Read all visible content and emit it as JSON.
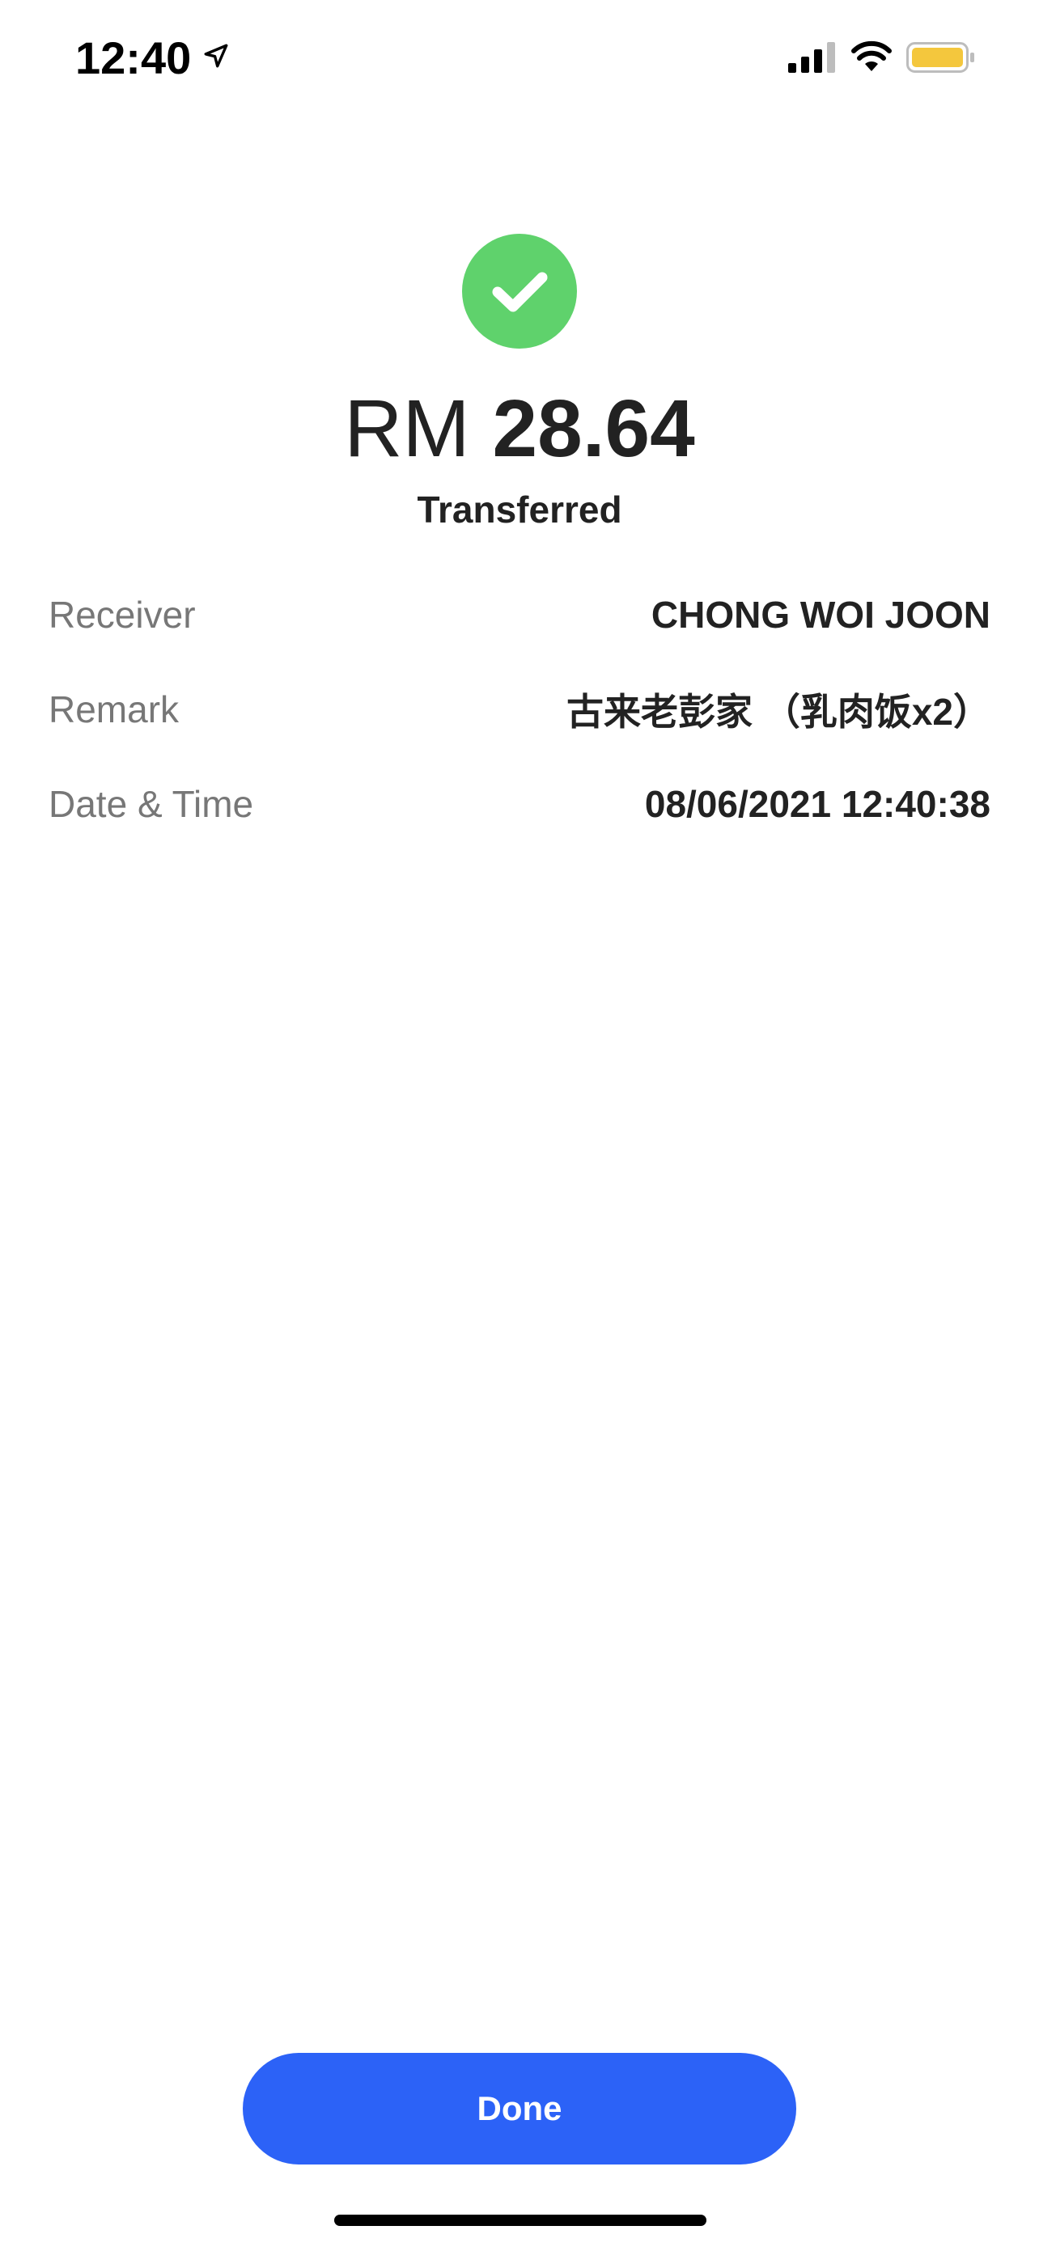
{
  "status_bar": {
    "time": "12:40",
    "icons": [
      "location-arrow-icon",
      "cellular-signal-icon",
      "wifi-icon",
      "battery-icon"
    ],
    "battery_color": "#f4c73d"
  },
  "result": {
    "icon": "checkmark-circle-icon",
    "icon_color": "#5fd26c",
    "currency": "RM",
    "amount": "28.64",
    "status": "Transferred"
  },
  "details": {
    "receiver": {
      "label": "Receiver",
      "value": "CHONG WOI JOON"
    },
    "remark": {
      "label": "Remark",
      "value": "古来老彭家 （乳肉饭x2）"
    },
    "datetime": {
      "label": "Date & Time",
      "value": "08/06/2021 12:40:38"
    }
  },
  "actions": {
    "done_label": "Done",
    "done_color": "#2c62f7"
  }
}
